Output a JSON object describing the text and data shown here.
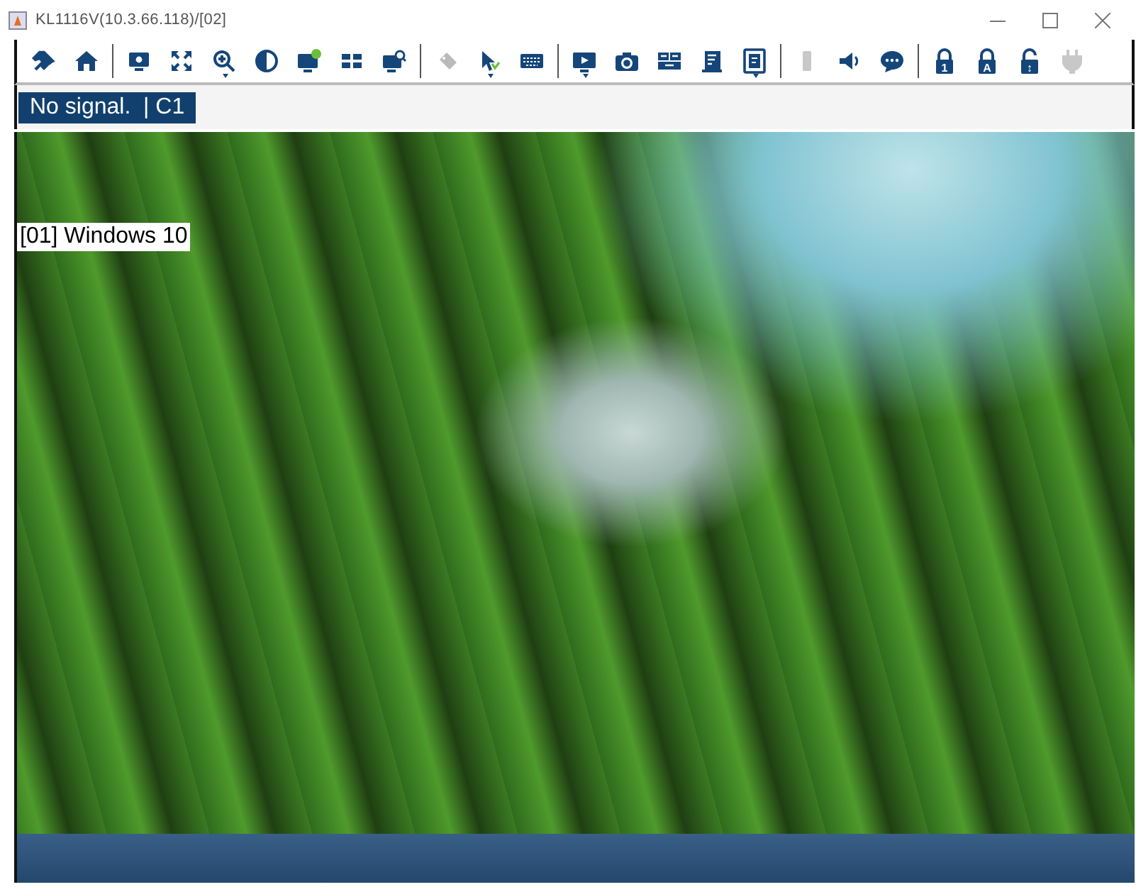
{
  "window": {
    "title": "KL1116V(10.3.66.118)/[02]"
  },
  "toolbar": {
    "groups": [
      [
        {
          "kind": "pin",
          "disabled": false,
          "menu": false
        },
        {
          "kind": "home",
          "disabled": false,
          "menu": false
        }
      ],
      [
        {
          "kind": "display-settings",
          "disabled": false,
          "menu": false
        },
        {
          "kind": "fullscreen",
          "disabled": false,
          "menu": false
        },
        {
          "kind": "zoom",
          "disabled": false,
          "menu": true
        },
        {
          "kind": "contrast",
          "disabled": false,
          "menu": false
        },
        {
          "kind": "monitor-badge",
          "disabled": false,
          "menu": false
        },
        {
          "kind": "grid",
          "disabled": false,
          "menu": false
        },
        {
          "kind": "monitor-search",
          "disabled": false,
          "menu": false
        }
      ],
      [
        {
          "kind": "tag",
          "disabled": true,
          "menu": false
        },
        {
          "kind": "pointer",
          "disabled": false,
          "menu": true
        },
        {
          "kind": "keyboard",
          "disabled": false,
          "menu": false
        }
      ],
      [
        {
          "kind": "monitor-play",
          "disabled": false,
          "menu": true
        },
        {
          "kind": "camera",
          "disabled": false,
          "menu": false
        },
        {
          "kind": "key-combo",
          "disabled": false,
          "menu": false
        },
        {
          "kind": "notepad",
          "disabled": false,
          "menu": false
        },
        {
          "kind": "book",
          "disabled": false,
          "menu": true
        }
      ],
      [
        {
          "kind": "usb",
          "disabled": true,
          "menu": false
        },
        {
          "kind": "speaker",
          "disabled": false,
          "menu": false
        },
        {
          "kind": "chat",
          "disabled": false,
          "menu": false
        }
      ],
      [
        {
          "kind": "lock",
          "glyph": "1",
          "disabled": false,
          "menu": false
        },
        {
          "kind": "lock",
          "glyph": "A",
          "disabled": false,
          "menu": false
        },
        {
          "kind": "unlock",
          "glyph": "↕",
          "disabled": false,
          "menu": false
        },
        {
          "kind": "plug",
          "disabled": true,
          "menu": false
        }
      ]
    ]
  },
  "status": {
    "label": "No signal.  | C1"
  },
  "view": {
    "osd_label": "[01] Windows 10"
  }
}
